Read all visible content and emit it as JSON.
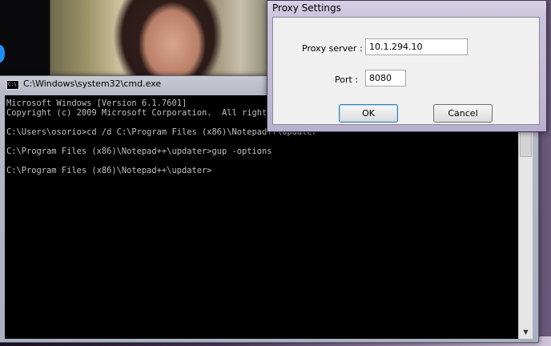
{
  "cmd_window": {
    "title": "C:\\Windows\\system32\\cmd.exe",
    "icon_text": "C:\\",
    "console_lines": [
      "Microsoft Windows [Version 6.1.7601]",
      "Copyright (c) 2009 Microsoft Corporation.  All rights reserved.",
      "",
      "C:\\Users\\osorio>cd /d C:\\Program Files (x86)\\Notepad++\\updater",
      "",
      "C:\\Program Files (x86)\\Notepad++\\updater>gup -options",
      "",
      "C:\\Program Files (x86)\\Notepad++\\updater>"
    ]
  },
  "proxy_dialog": {
    "title": "Proxy Settings",
    "server_label": "Proxy server :",
    "server_value": "10.1.294.10",
    "port_label": "Port :",
    "port_value": "8080",
    "ok_label": "OK",
    "cancel_label": "Cancel"
  },
  "icons": {
    "scroll_up": "▲",
    "scroll_down": "▼"
  }
}
